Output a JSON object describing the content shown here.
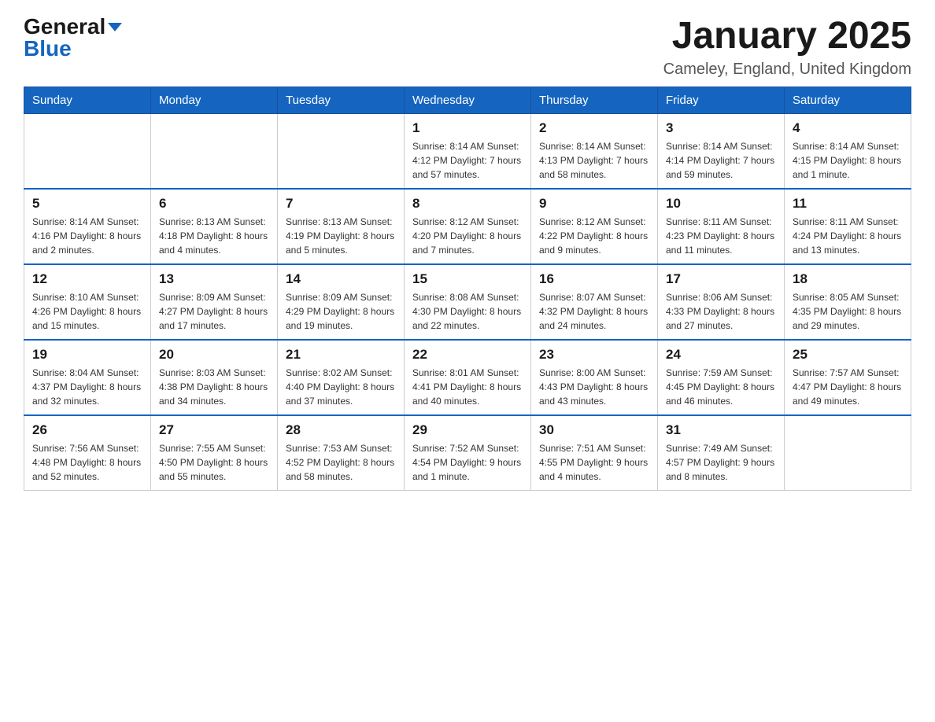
{
  "header": {
    "logo_general": "General",
    "logo_blue": "Blue",
    "month_title": "January 2025",
    "location": "Cameley, England, United Kingdom"
  },
  "calendar": {
    "days_of_week": [
      "Sunday",
      "Monday",
      "Tuesday",
      "Wednesday",
      "Thursday",
      "Friday",
      "Saturday"
    ],
    "weeks": [
      [
        {
          "day": "",
          "info": ""
        },
        {
          "day": "",
          "info": ""
        },
        {
          "day": "",
          "info": ""
        },
        {
          "day": "1",
          "info": "Sunrise: 8:14 AM\nSunset: 4:12 PM\nDaylight: 7 hours and 57 minutes."
        },
        {
          "day": "2",
          "info": "Sunrise: 8:14 AM\nSunset: 4:13 PM\nDaylight: 7 hours and 58 minutes."
        },
        {
          "day": "3",
          "info": "Sunrise: 8:14 AM\nSunset: 4:14 PM\nDaylight: 7 hours and 59 minutes."
        },
        {
          "day": "4",
          "info": "Sunrise: 8:14 AM\nSunset: 4:15 PM\nDaylight: 8 hours and 1 minute."
        }
      ],
      [
        {
          "day": "5",
          "info": "Sunrise: 8:14 AM\nSunset: 4:16 PM\nDaylight: 8 hours and 2 minutes."
        },
        {
          "day": "6",
          "info": "Sunrise: 8:13 AM\nSunset: 4:18 PM\nDaylight: 8 hours and 4 minutes."
        },
        {
          "day": "7",
          "info": "Sunrise: 8:13 AM\nSunset: 4:19 PM\nDaylight: 8 hours and 5 minutes."
        },
        {
          "day": "8",
          "info": "Sunrise: 8:12 AM\nSunset: 4:20 PM\nDaylight: 8 hours and 7 minutes."
        },
        {
          "day": "9",
          "info": "Sunrise: 8:12 AM\nSunset: 4:22 PM\nDaylight: 8 hours and 9 minutes."
        },
        {
          "day": "10",
          "info": "Sunrise: 8:11 AM\nSunset: 4:23 PM\nDaylight: 8 hours and 11 minutes."
        },
        {
          "day": "11",
          "info": "Sunrise: 8:11 AM\nSunset: 4:24 PM\nDaylight: 8 hours and 13 minutes."
        }
      ],
      [
        {
          "day": "12",
          "info": "Sunrise: 8:10 AM\nSunset: 4:26 PM\nDaylight: 8 hours and 15 minutes."
        },
        {
          "day": "13",
          "info": "Sunrise: 8:09 AM\nSunset: 4:27 PM\nDaylight: 8 hours and 17 minutes."
        },
        {
          "day": "14",
          "info": "Sunrise: 8:09 AM\nSunset: 4:29 PM\nDaylight: 8 hours and 19 minutes."
        },
        {
          "day": "15",
          "info": "Sunrise: 8:08 AM\nSunset: 4:30 PM\nDaylight: 8 hours and 22 minutes."
        },
        {
          "day": "16",
          "info": "Sunrise: 8:07 AM\nSunset: 4:32 PM\nDaylight: 8 hours and 24 minutes."
        },
        {
          "day": "17",
          "info": "Sunrise: 8:06 AM\nSunset: 4:33 PM\nDaylight: 8 hours and 27 minutes."
        },
        {
          "day": "18",
          "info": "Sunrise: 8:05 AM\nSunset: 4:35 PM\nDaylight: 8 hours and 29 minutes."
        }
      ],
      [
        {
          "day": "19",
          "info": "Sunrise: 8:04 AM\nSunset: 4:37 PM\nDaylight: 8 hours and 32 minutes."
        },
        {
          "day": "20",
          "info": "Sunrise: 8:03 AM\nSunset: 4:38 PM\nDaylight: 8 hours and 34 minutes."
        },
        {
          "day": "21",
          "info": "Sunrise: 8:02 AM\nSunset: 4:40 PM\nDaylight: 8 hours and 37 minutes."
        },
        {
          "day": "22",
          "info": "Sunrise: 8:01 AM\nSunset: 4:41 PM\nDaylight: 8 hours and 40 minutes."
        },
        {
          "day": "23",
          "info": "Sunrise: 8:00 AM\nSunset: 4:43 PM\nDaylight: 8 hours and 43 minutes."
        },
        {
          "day": "24",
          "info": "Sunrise: 7:59 AM\nSunset: 4:45 PM\nDaylight: 8 hours and 46 minutes."
        },
        {
          "day": "25",
          "info": "Sunrise: 7:57 AM\nSunset: 4:47 PM\nDaylight: 8 hours and 49 minutes."
        }
      ],
      [
        {
          "day": "26",
          "info": "Sunrise: 7:56 AM\nSunset: 4:48 PM\nDaylight: 8 hours and 52 minutes."
        },
        {
          "day": "27",
          "info": "Sunrise: 7:55 AM\nSunset: 4:50 PM\nDaylight: 8 hours and 55 minutes."
        },
        {
          "day": "28",
          "info": "Sunrise: 7:53 AM\nSunset: 4:52 PM\nDaylight: 8 hours and 58 minutes."
        },
        {
          "day": "29",
          "info": "Sunrise: 7:52 AM\nSunset: 4:54 PM\nDaylight: 9 hours and 1 minute."
        },
        {
          "day": "30",
          "info": "Sunrise: 7:51 AM\nSunset: 4:55 PM\nDaylight: 9 hours and 4 minutes."
        },
        {
          "day": "31",
          "info": "Sunrise: 7:49 AM\nSunset: 4:57 PM\nDaylight: 9 hours and 8 minutes."
        },
        {
          "day": "",
          "info": ""
        }
      ]
    ]
  }
}
